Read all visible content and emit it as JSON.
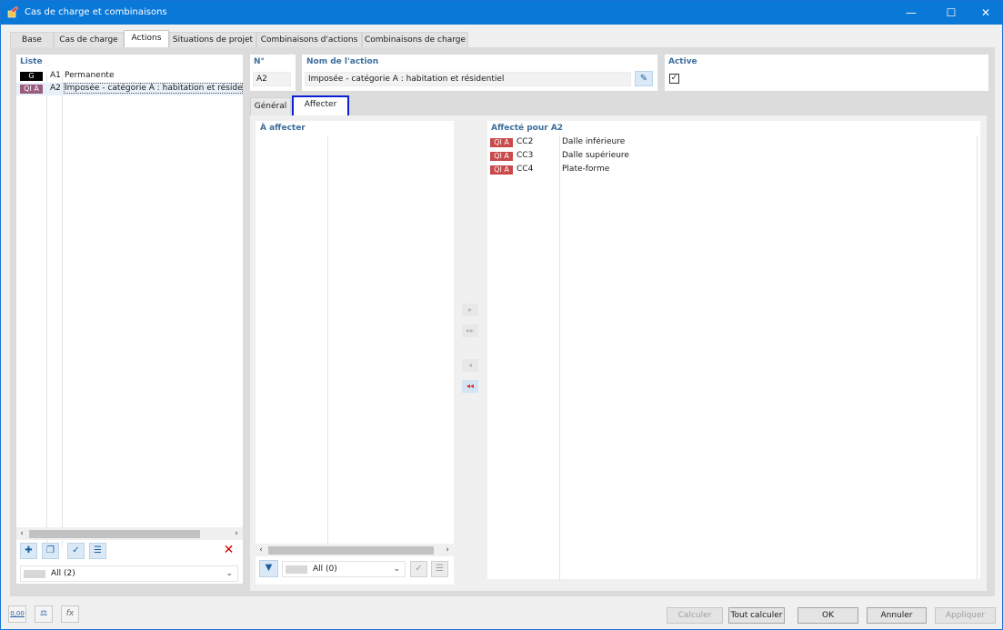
{
  "window": {
    "title": "Cas de charge et combinaisons",
    "controls": {
      "minimize": "—",
      "maximize": "☐",
      "close": "✕"
    }
  },
  "tabs": [
    "Base",
    "Cas de charge",
    "Actions",
    "Situations de projet",
    "Combinaisons d'actions",
    "Combinaisons de charge"
  ],
  "active_tab": "Actions",
  "list": {
    "label": "Liste",
    "items": [
      {
        "badge": "G",
        "badge_color": "#000000",
        "id": "A1",
        "name": "Permanente"
      },
      {
        "badge": "QI A",
        "badge_color": "#9a5c7e",
        "id": "A2",
        "name": "Imposée - catégorie A : habitation et résidentiel"
      }
    ],
    "filter": "All (2)"
  },
  "number": {
    "label": "N°",
    "value": "A2"
  },
  "action_name": {
    "label": "Nom de l'action",
    "value": "Imposée - catégorie A : habitation et résidentiel"
  },
  "active": {
    "label": "Active",
    "checked": true,
    "mark": "✓"
  },
  "subtabs": [
    "Général",
    "Affecter"
  ],
  "active_subtab": "Affecter",
  "to_assign": {
    "label": "À affecter",
    "filter": "All (0)"
  },
  "assigned": {
    "label": "Affecté pour A2",
    "items": [
      {
        "badge": "QI A",
        "badge_color": "#c94a4a",
        "id": "CC2",
        "name": "Dalle inférieure"
      },
      {
        "badge": "QI A",
        "badge_color": "#c94a4a",
        "id": "CC3",
        "name": "Dalle supérieure"
      },
      {
        "badge": "QI A",
        "badge_color": "#c94a4a",
        "id": "CC4",
        "name": "Plate-forme"
      }
    ]
  },
  "transfer_buttons": [
    "▸",
    "▸▸",
    "◂",
    "◂◂"
  ],
  "footer": {
    "icons": [
      "0,00",
      "⚖",
      "fx"
    ],
    "buttons": {
      "calc": "Calculer",
      "calc_all": "Tout calculer",
      "ok": "OK",
      "cancel": "Annuler",
      "apply": "Appliquer"
    }
  },
  "colors": {
    "title_bar": "#0a78d7",
    "section_label": "#3c6e9c",
    "highlight": "#0b1fd8"
  }
}
